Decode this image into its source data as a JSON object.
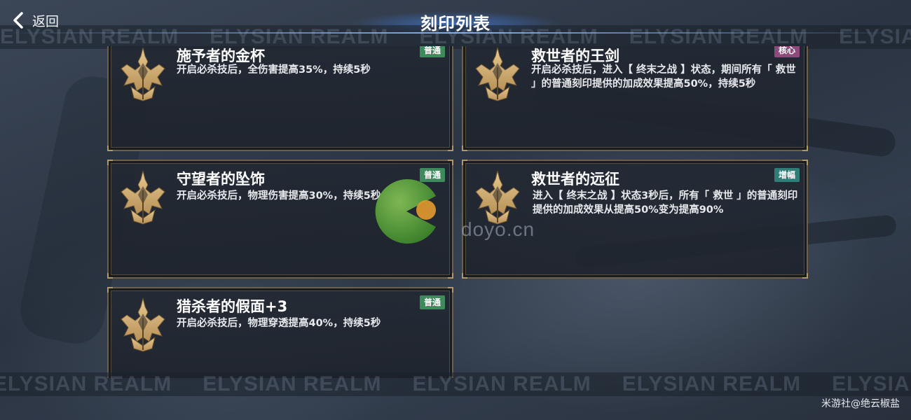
{
  "header": {
    "back_label": "返回",
    "title": "刻印列表"
  },
  "band_text": "ELYSIAN REALM",
  "cards": [
    {
      "name": "施予者的金杯",
      "tag": "普通",
      "tag_color": "#3e8a5d",
      "desc": "开启必杀技后，全伤害提高35%，持续5秒"
    },
    {
      "name": "救世者的王剑",
      "tag": "核心",
      "tag_color": "#8d4a7a",
      "desc": "开启必杀技后，进入【 终末之战 】状态，期间所有「 救世 」的普通刻印提供的加成效果提高50%，持续5秒"
    },
    {
      "name": "守望者的坠饰",
      "tag": "普通",
      "tag_color": "#3e8a5d",
      "desc": "开启必杀技后，物理伤害提高30%，持续5秒"
    },
    {
      "name": "救世者的远征",
      "tag": "增幅",
      "tag_color": "#2f7d76",
      "desc": "进入【 终末之战 】状态3秒后，所有「 救世 」的普通刻印提供的加成效果从提高50%变为提高90%"
    },
    {
      "name": "猎杀者的假面+3",
      "tag": "普通",
      "tag_color": "#3e8a5d",
      "desc": "开启必杀技后，物理穿透提高40%，持续5秒"
    }
  ],
  "watermark": {
    "text": "doyo.cn"
  },
  "credit": "米游社@绝云椒盐",
  "icons": {
    "back": "chevron-left-icon",
    "emblem": "crest-emblem-icon"
  }
}
